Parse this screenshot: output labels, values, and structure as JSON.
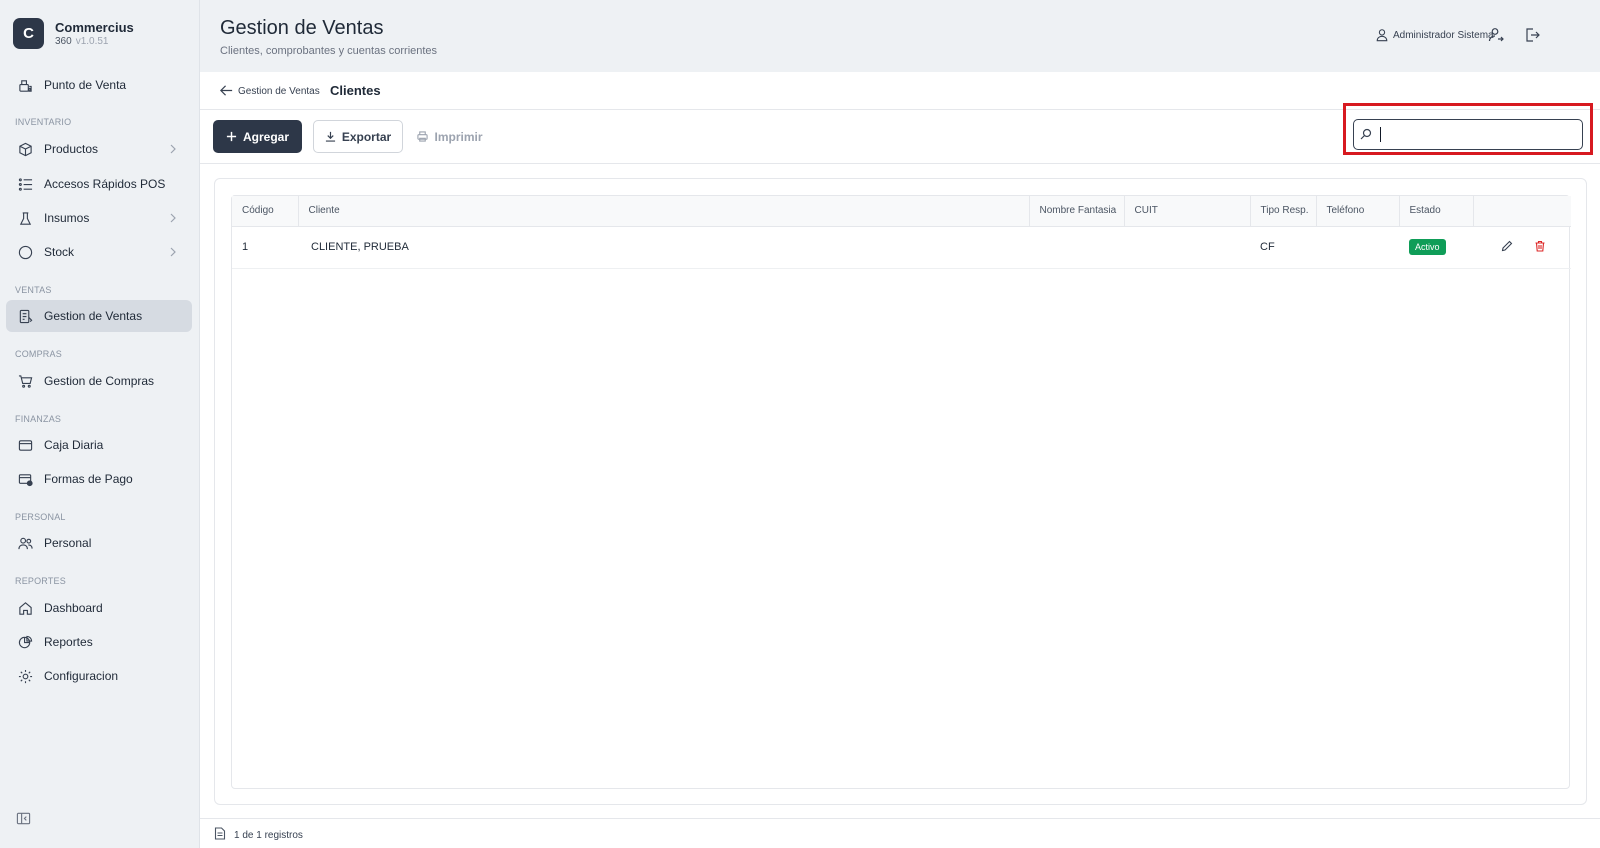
{
  "brand": {
    "logo_letter": "C",
    "name": "Commercius",
    "sub": "360",
    "version": "v1.0.51"
  },
  "sidebar": {
    "items": [
      {
        "label": "Punto de Venta",
        "icon": "pos-icon"
      },
      {
        "section": "INVENTARIO"
      },
      {
        "label": "Productos",
        "icon": "box-icon",
        "chevron": true
      },
      {
        "label": "Accesos Rápidos POS",
        "icon": "list-icon"
      },
      {
        "label": "Insumos",
        "icon": "flask-icon",
        "chevron": true
      },
      {
        "label": "Stock",
        "icon": "circle-icon",
        "chevron": true
      },
      {
        "section": "VENTAS"
      },
      {
        "label": "Gestion de Ventas",
        "icon": "receipt-icon",
        "active": true
      },
      {
        "section": "COMPRAS"
      },
      {
        "label": "Gestion de Compras",
        "icon": "cart-icon"
      },
      {
        "section": "FINANZAS"
      },
      {
        "label": "Caja Diaria",
        "icon": "wallet-icon"
      },
      {
        "label": "Formas de Pago",
        "icon": "payment-icon"
      },
      {
        "section": "PERSONAL"
      },
      {
        "label": "Personal",
        "icon": "users-icon"
      },
      {
        "section": "REPORTES"
      },
      {
        "label": "Dashboard",
        "icon": "home-icon"
      },
      {
        "label": "Reportes",
        "icon": "chart-icon"
      },
      {
        "label": "Configuracion",
        "icon": "gear-icon"
      }
    ]
  },
  "header": {
    "title": "Gestion de Ventas",
    "subtitle": "Clientes, comprobantes y cuentas corrientes",
    "user": "Administrador Sistema"
  },
  "breadcrumb": {
    "parent": "Gestion de Ventas",
    "current": "Clientes"
  },
  "toolbar": {
    "add_label": "Agregar",
    "export_label": "Exportar",
    "print_label": "Imprimir",
    "search_value": ""
  },
  "table": {
    "columns": [
      "Código",
      "Cliente",
      "Nombre Fantasia",
      "CUIT",
      "Tipo Resp.",
      "Teléfono",
      "Estado",
      ""
    ],
    "rows": [
      {
        "codigo": "1",
        "cliente": "CLIENTE, PRUEBA",
        "fantasia": "",
        "cuit": "",
        "tipo": "CF",
        "telefono": "",
        "estado": "Activo"
      }
    ]
  },
  "footer": {
    "records": "1 de 1 registros"
  },
  "colors": {
    "primary": "#2d3748",
    "active_badge": "#0f9d58",
    "highlight": "#d71920",
    "delete": "#dc2626"
  }
}
